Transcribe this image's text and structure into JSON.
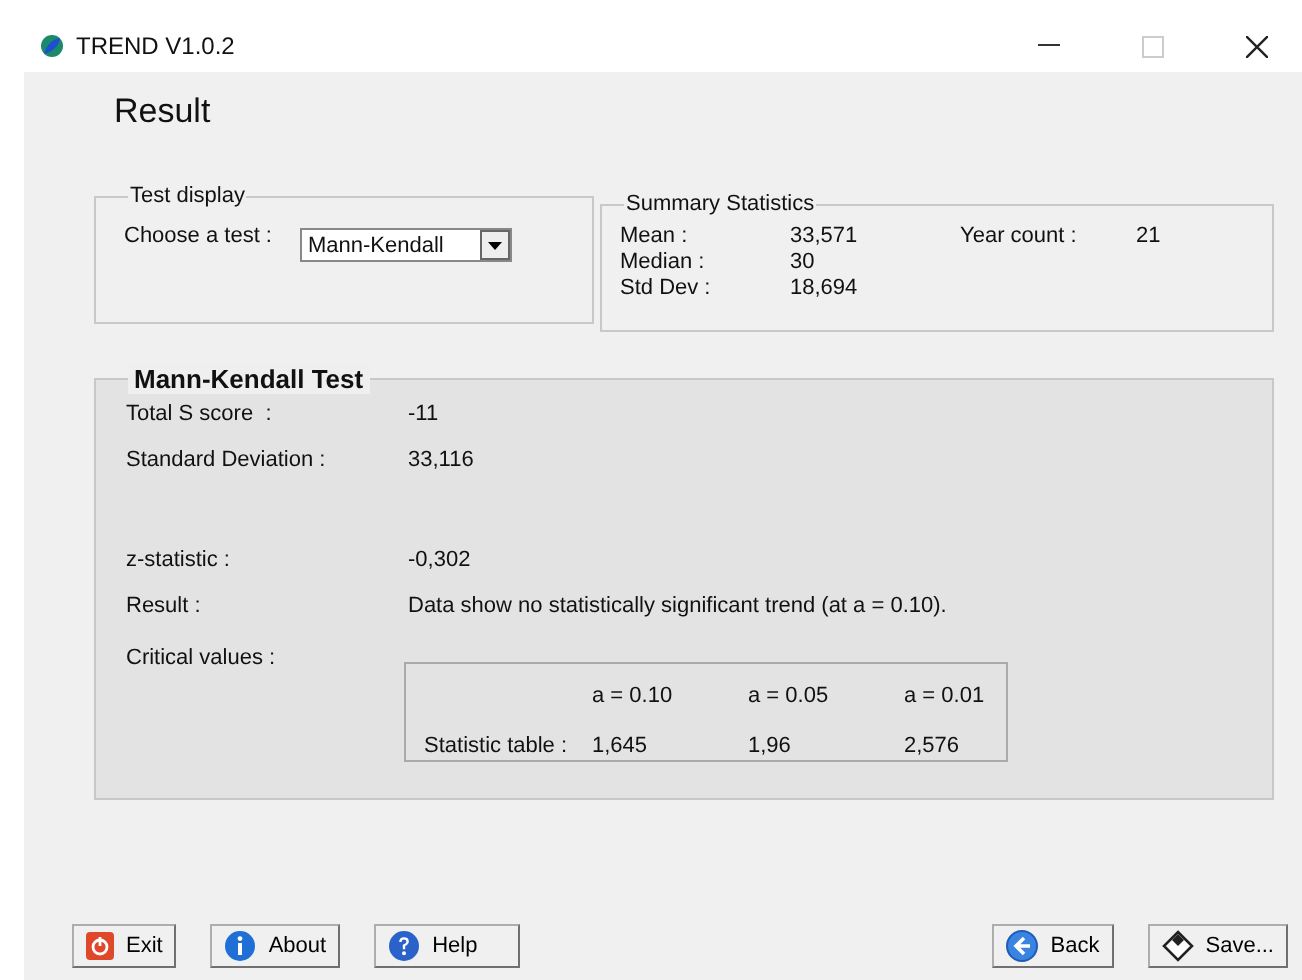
{
  "window": {
    "title": "TREND V1.0.2"
  },
  "heading": "Result",
  "test_display": {
    "title": "Test display",
    "label": "Choose a test :",
    "value": "Mann-Kendall"
  },
  "summary": {
    "title": "Summary Statistics",
    "rows": [
      {
        "label": "Mean :",
        "value": "33,571"
      },
      {
        "label": "Median :",
        "value": "30"
      },
      {
        "label": "Std Dev :",
        "value": "18,694"
      }
    ],
    "extra": {
      "label": "Year count :",
      "value": "21"
    }
  },
  "test": {
    "title": "Mann-Kendall Test",
    "rows": [
      {
        "label": "Total S score  :",
        "value": "-11"
      },
      {
        "label": "Standard Deviation :",
        "value": "33,116"
      },
      {
        "label": "z-statistic :",
        "value": "-0,302"
      },
      {
        "label": "Result :",
        "value": "Data show no statistically significant trend (at a = 0.10)."
      }
    ],
    "critical": {
      "label": "Critical values :",
      "columns": [
        "a = 0.10",
        "a = 0.05",
        "a = 0.01"
      ],
      "row_label": "Statistic table :",
      "values": [
        "1,645",
        "1,96",
        "2,576"
      ]
    }
  },
  "buttons": [
    {
      "kind": "exit",
      "label": "Exit"
    },
    {
      "kind": "about",
      "label": "About"
    },
    {
      "kind": "help",
      "label": "Help"
    },
    {
      "kind": "back",
      "label": "Back"
    },
    {
      "kind": "save",
      "label": "Save..."
    }
  ]
}
